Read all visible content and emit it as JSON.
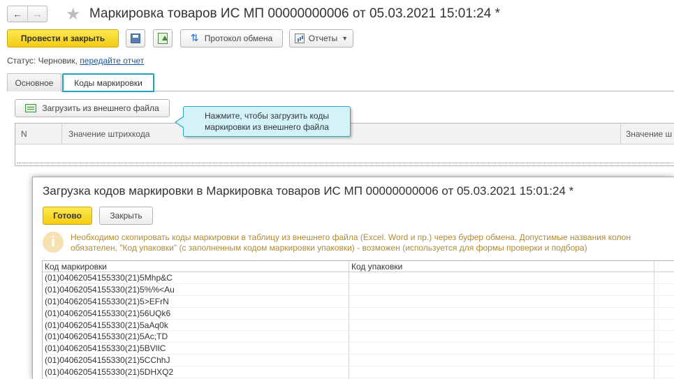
{
  "window": {
    "title": "Маркировка товаров ИС МП 00000000006 от 05.03.2021 15:01:24 *"
  },
  "toolbar": {
    "post_close_label": "Провести и закрыть",
    "exchange_protocol_label": "Протокол обмена",
    "reports_label": "Отчеты"
  },
  "status": {
    "label": "Статус:",
    "value": "Черновик,",
    "link": "передайте отчет"
  },
  "tabs": [
    {
      "label": "Основное"
    },
    {
      "label": "Коды маркировки"
    }
  ],
  "codes_tab": {
    "load_button_label": "Загрузить из внешнего файла",
    "tooltip": [
      "Нажмите, чтобы загрузить коды",
      "маркировки из внешнего файла"
    ],
    "columns": [
      "N",
      "Значение штрихкода",
      "Значение ш"
    ]
  },
  "dialog": {
    "title": "Загрузка кодов маркировки в Маркировка товаров ИС МП 00000000006 от 05.03.2021 15:01:24 *",
    "done_label": "Готово",
    "close_label": "Закрыть",
    "info_lines": [
      "Необходимо скопировать коды маркировки в таблицу из внешнего файла (Excel. Word и пр.) через буфер обмена. Допустимые названия колон",
      "обязателен, \"Код упаковки\" (с заполненным кодом маркировки упаковки) - возможен (используется для формы проверки и подбора)"
    ],
    "columns": [
      "Код маркировки",
      "Код упаковки"
    ],
    "rows": [
      "(01)04062054155330(21)5Mhp&C",
      "(01)04062054155330(21)5%%<Au",
      "(01)04062054155330(21)5>EFrN",
      "(01)04062054155330(21)56UQk6",
      "(01)04062054155330(21)5aAq0k",
      "(01)04062054155330(21)5Ac;TD",
      "(01)04062054155330(21)5BVlIC",
      "(01)04062054155330(21)5CChhJ",
      "(01)04062054155330(21)5DHXQ2"
    ]
  }
}
